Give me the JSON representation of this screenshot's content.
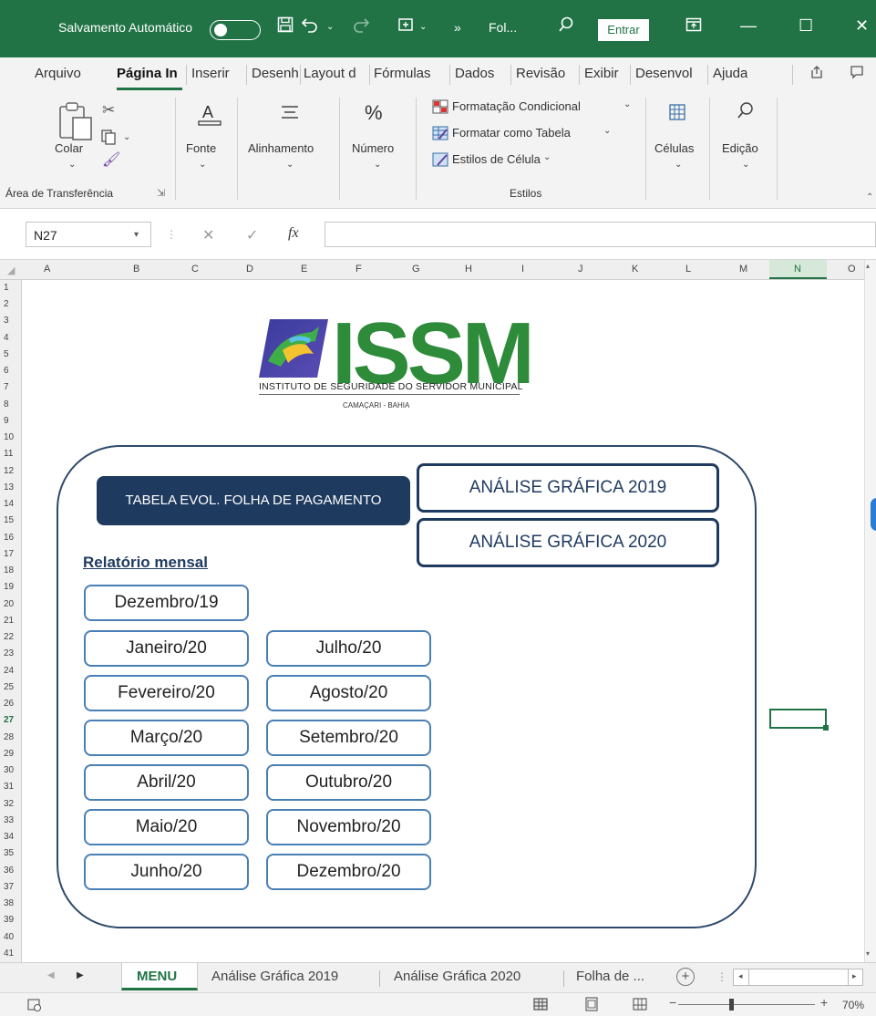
{
  "titlebar": {
    "autosave": "Salvamento Automático",
    "more": "»",
    "file": "Fol...",
    "signin": "Entrar"
  },
  "tabs": [
    "Arquivo",
    "Página In",
    "Inserir",
    "Desenhar",
    "Layout d",
    "Fórmulas",
    "Dados",
    "Revisão",
    "Exibir",
    "Desenvol",
    "Ajuda"
  ],
  "ribbon": {
    "colar": "Colar",
    "fonte": "Fonte",
    "alinhamento": "Alinhamento",
    "numero": "Número",
    "cond_format": "Formatação Condicional",
    "format_table": "Formatar como Tabela",
    "cell_styles": "Estilos de Célula",
    "celulas": "Células",
    "edicao": "Edição",
    "group_clipboard": "Área de Transferência",
    "group_styles": "Estilos"
  },
  "formula": {
    "cell_ref": "N27",
    "fx": "fx",
    "value": ""
  },
  "columns": [
    "A",
    "B",
    "C",
    "D",
    "E",
    "F",
    "G",
    "H",
    "I",
    "J",
    "K",
    "L",
    "M",
    "N",
    "O"
  ],
  "logo": {
    "name": "ISSM",
    "subtitle": "INSTITUTO DE SEGURIDADE DO SERVIDOR MUNICIPAL",
    "city": "CAMAÇARI - BAHIA"
  },
  "menu": {
    "tabela": "TABELA EVOL. FOLHA DE PAGAMENTO",
    "analise2019": "ANÁLISE GRÁFICA 2019",
    "analise2020": "ANÁLISE GRÁFICA 2020",
    "relatorio": "Relatório mensal",
    "months_left": [
      "Dezembro/19",
      "Janeiro/20",
      "Fevereiro/20",
      "Março/20",
      "Abril/20",
      "Maio/20",
      "Junho/20"
    ],
    "months_right": [
      "Julho/20",
      "Agosto/20",
      "Setembro/20",
      "Outubro/20",
      "Novembro/20",
      "Dezembro/20"
    ]
  },
  "sheets": {
    "active": "MENU",
    "s2": "Análise Gráfica 2019",
    "s3": "Análise Gráfica 2020",
    "s4": "Folha de ..."
  },
  "status": {
    "zoom": "70%"
  },
  "colors": {
    "excel_green": "#217346",
    "navy": "#1f3a5f",
    "logo_green": "#2e8b3a",
    "month_border": "#4a7fb5"
  }
}
